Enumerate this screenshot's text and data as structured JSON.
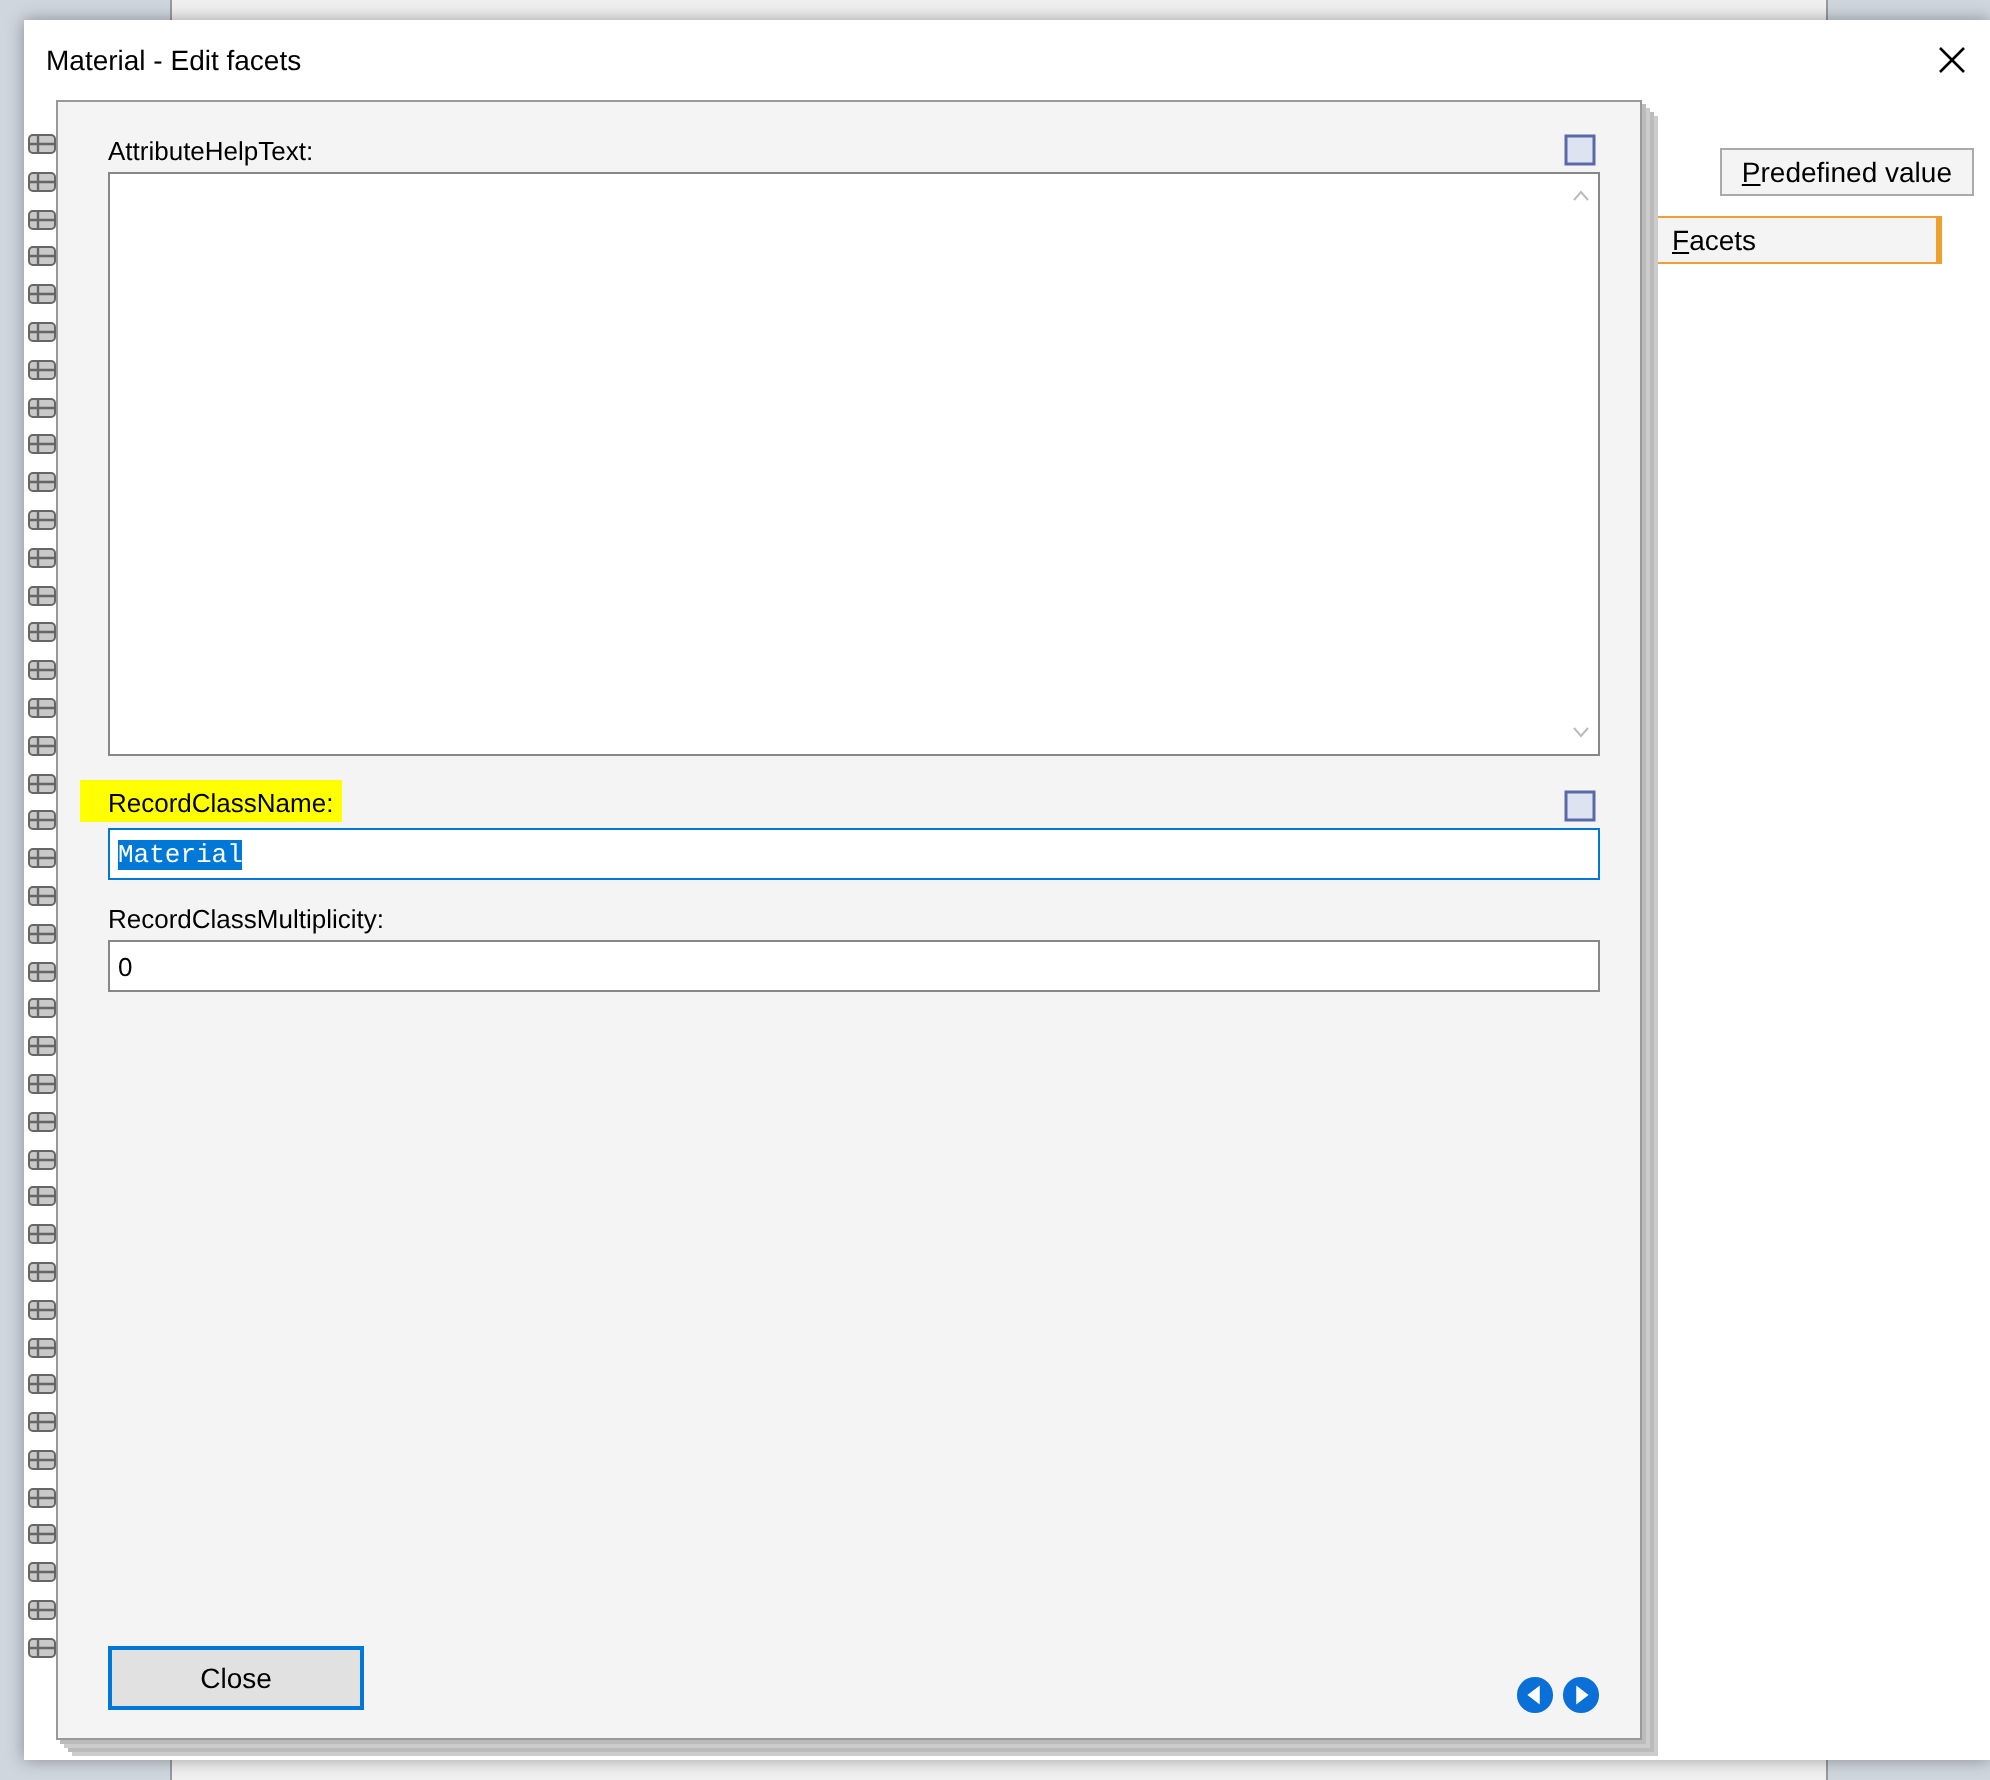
{
  "dialog": {
    "title": "Material - Edit facets",
    "fields": [
      {
        "kind": "multiline",
        "label": "AttributeHelpText:",
        "highlighted": false
      },
      {
        "kind": "line",
        "label": "RecordClassName:",
        "value": "Material",
        "highlighted": true,
        "focused": true,
        "value_selected": true
      },
      {
        "kind": "line",
        "label": "RecordClassMultiplicity:",
        "value": "0",
        "highlighted": false
      }
    ],
    "tabs": [
      {
        "label": "Predefined value",
        "selected": false
      },
      {
        "label": "Facets",
        "selected": true
      }
    ],
    "close_button": "Close"
  }
}
